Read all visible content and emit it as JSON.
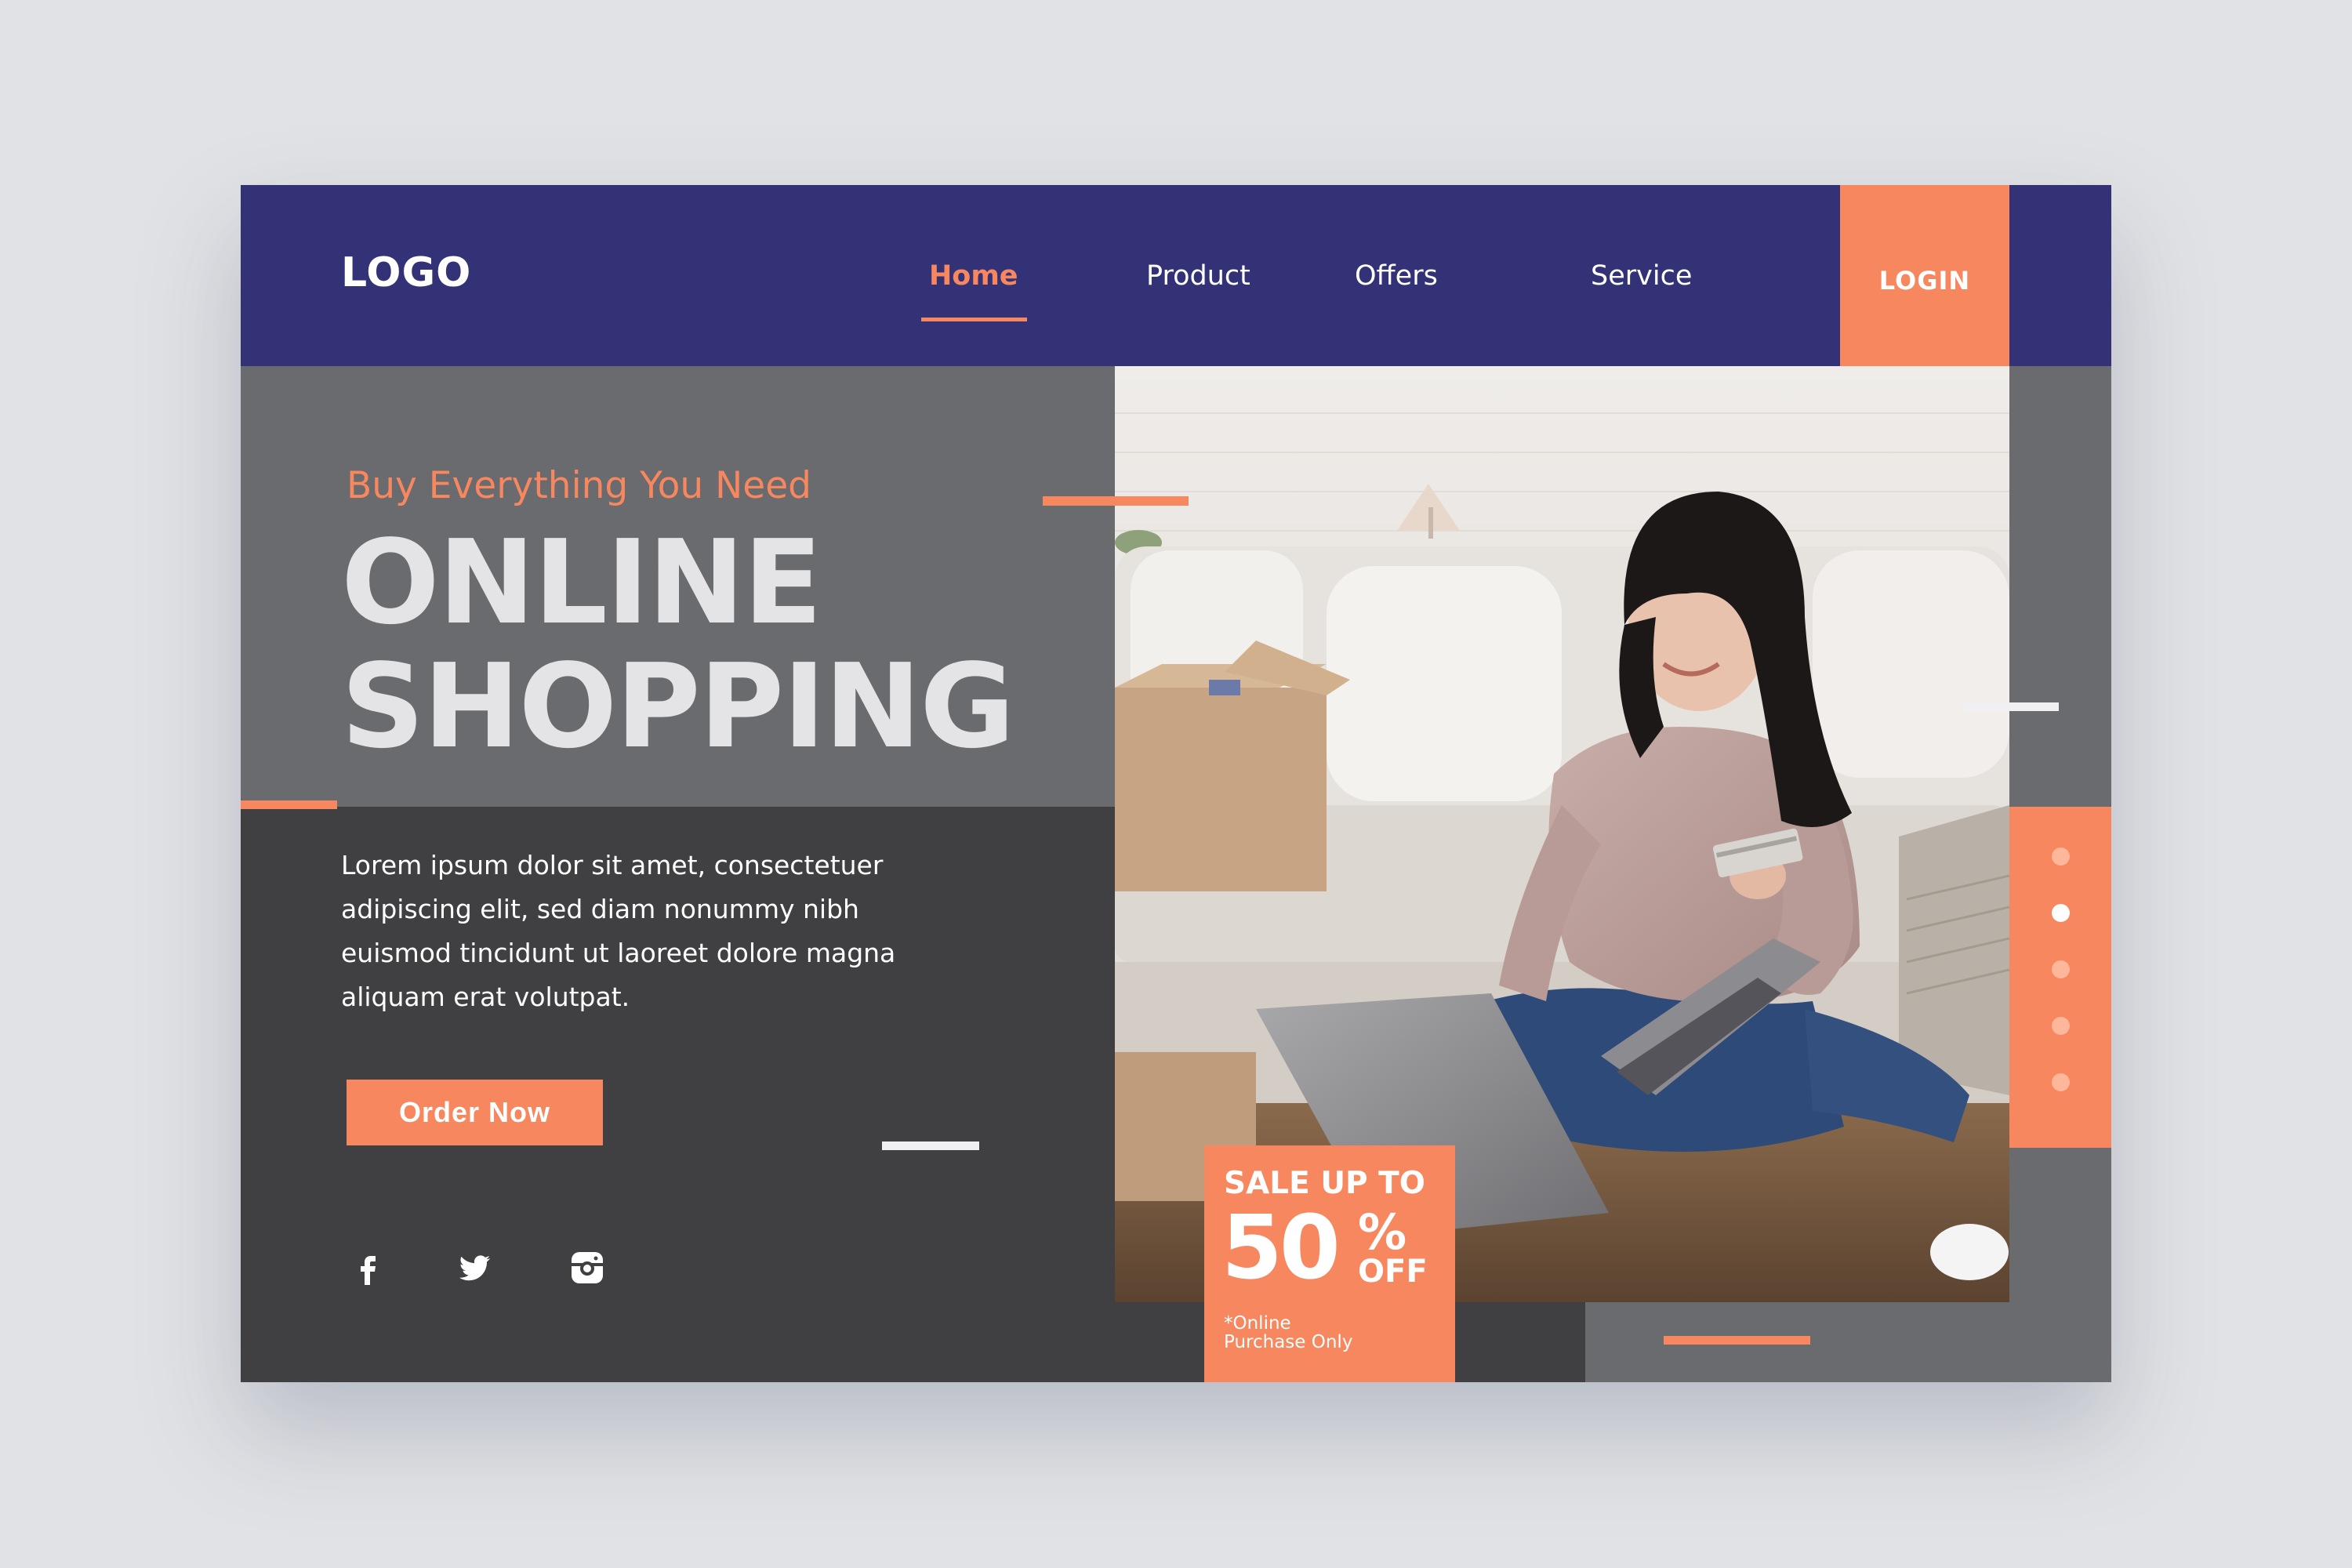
{
  "header": {
    "logo": "LOGO",
    "nav": [
      {
        "label": "Home",
        "active": true
      },
      {
        "label": "Product",
        "active": false
      },
      {
        "label": "Offers",
        "active": false
      },
      {
        "label": "Service",
        "active": false
      }
    ],
    "login_label": "LOGIN"
  },
  "hero": {
    "subtitle": "Buy Everything You Need",
    "title_line1": "ONLINE",
    "title_line2": "SHOPPING",
    "body_lines": [
      "Lorem ipsum dolor sit amet, consectetuer",
      "adipiscing elit, sed diam nonummy nibh",
      "euismod tincidunt ut laoreet dolore magna",
      "aliquam erat volutpat."
    ],
    "cta_label": "Order Now"
  },
  "social": [
    "facebook-icon",
    "twitter-icon",
    "instagram-icon"
  ],
  "sale": {
    "line1": "SALE UP TO",
    "number": "50",
    "percent": "%",
    "off": "OFF",
    "note_line1": "*Online",
    "note_line2": "Purchase Only"
  },
  "pager": {
    "count": 5,
    "active_index": 1
  },
  "colors": {
    "header_bg": "#333277",
    "accent": "#f7875e",
    "panel_gray": "#6a6b6f",
    "panel_dark": "#403f41",
    "page_bg": "#e1e2e5"
  }
}
